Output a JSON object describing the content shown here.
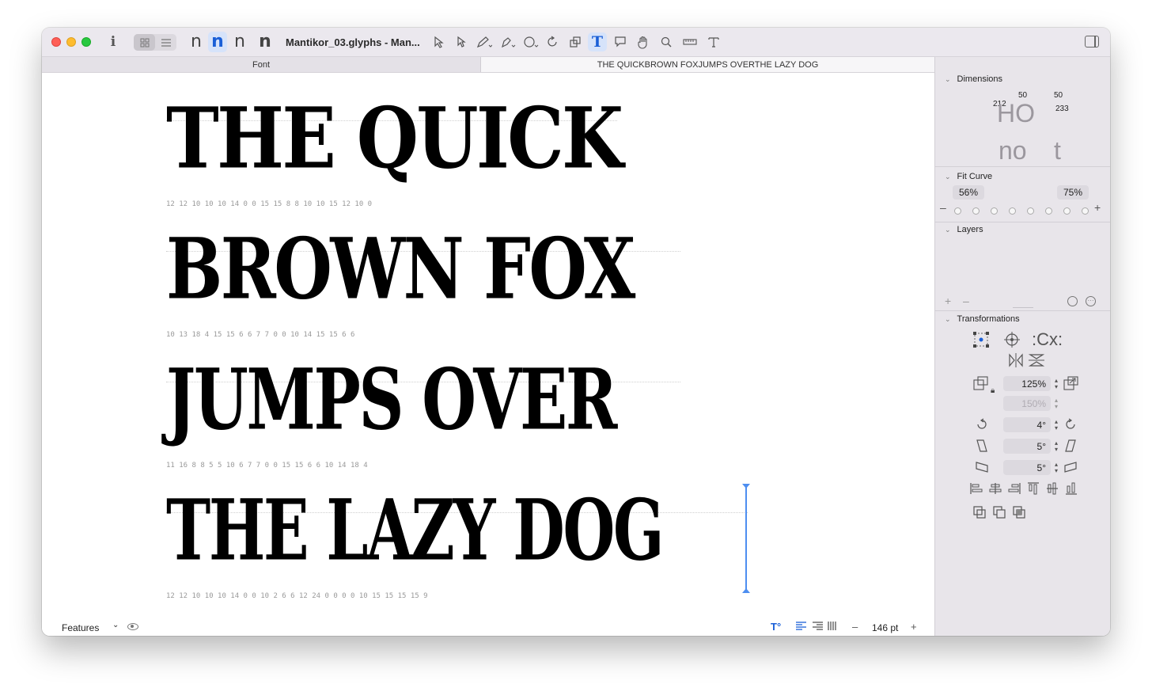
{
  "window": {
    "title": "Mantikor_03.glyphs - Man...",
    "info_icon": "i"
  },
  "toolbar": {
    "view_modes": [
      "grid-view-icon",
      "list-view-icon"
    ],
    "glyph_previews": [
      "n",
      "n",
      "n",
      "n"
    ],
    "tools": [
      "select-tool-icon",
      "select-all-layers-icon",
      "draw-tool-icon",
      "pen-tool-icon",
      "primitives-tool-icon",
      "rotate-tool-icon",
      "scale-tool-icon",
      "text-tool-icon",
      "annotation-tool-icon",
      "hand-tool-icon",
      "zoom-tool-icon",
      "measure-tool-icon",
      "type-tool-icon"
    ]
  },
  "tabs": {
    "font": "Font",
    "text": "THE QUICKBROWN FOXJUMPS OVERTHE LAZY DOG"
  },
  "canvas": {
    "lines": [
      "THE QUICK",
      "BROWN FOX",
      "JUMPS OVER",
      "THE LAZY DOG"
    ],
    "metrics": [
      "12   12 10       10 10   14 0 0 15      15 8   8 10  10 15   12 10    0",
      "10   13 18       4 15    15 6           6 7    7 0 0 10  14 15   15 6     6",
      "11   16 8    8 5    5 10   6 7   7 0 0 15   15 6   6 10   14 18   4",
      "12   12 10       10 10   14 0 0 10   2 6    6 12   24 0   0 0 0 10   15 15   15 15   9"
    ]
  },
  "bottombar": {
    "features_label": "Features",
    "point_size": "146 pt",
    "minus": "–",
    "plus": "+"
  },
  "panel": {
    "dimensions": {
      "title": "Dimensions",
      "top_left": "50",
      "top_right": "50",
      "left": "212",
      "right": "233",
      "word_top": "HO",
      "word_bottom": "no",
      "word_t": "t"
    },
    "fit_curve": {
      "title": "Fit Curve",
      "min": "56%",
      "max": "75%",
      "dots": 8
    },
    "layers": {
      "title": "Layers"
    },
    "transformations": {
      "title": "Transformations",
      "scale": "125%",
      "scale_locked": "150%",
      "rotate": "4°",
      "slant_h": "5°",
      "slant_v": "5°"
    }
  },
  "colors": {
    "accent": "#1a5fd7",
    "cursor": "#4d8ef0",
    "panel_bg": "#e8e5ea"
  }
}
